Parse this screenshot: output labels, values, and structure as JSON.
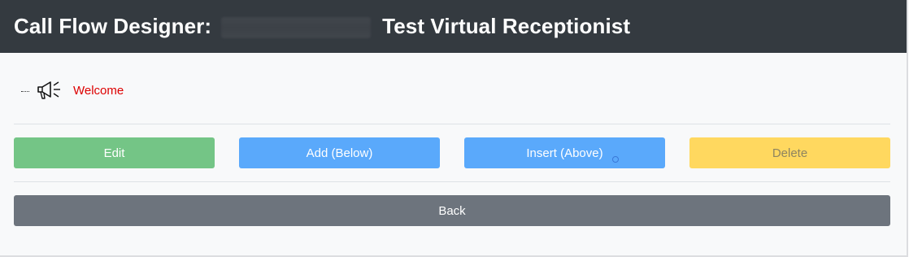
{
  "header": {
    "title_prefix": "Call Flow Designer:",
    "title_suffix": "Test Virtual Receptionist"
  },
  "tree": {
    "node_icon": "megaphone-icon",
    "node_label": "Welcome"
  },
  "actions": {
    "edit_label": "Edit",
    "add_label": "Add (Below)",
    "insert_label": "Insert (Above)",
    "delete_label": "Delete",
    "back_label": "Back"
  },
  "colors": {
    "header_bg": "#343a40",
    "page_bg": "#f8f9fa",
    "edit": "#74c586",
    "add": "#5aa9fb",
    "insert": "#5aa9fb",
    "delete": "#ffd85f",
    "back": "#6d747d",
    "node_label": "#dd0000"
  }
}
